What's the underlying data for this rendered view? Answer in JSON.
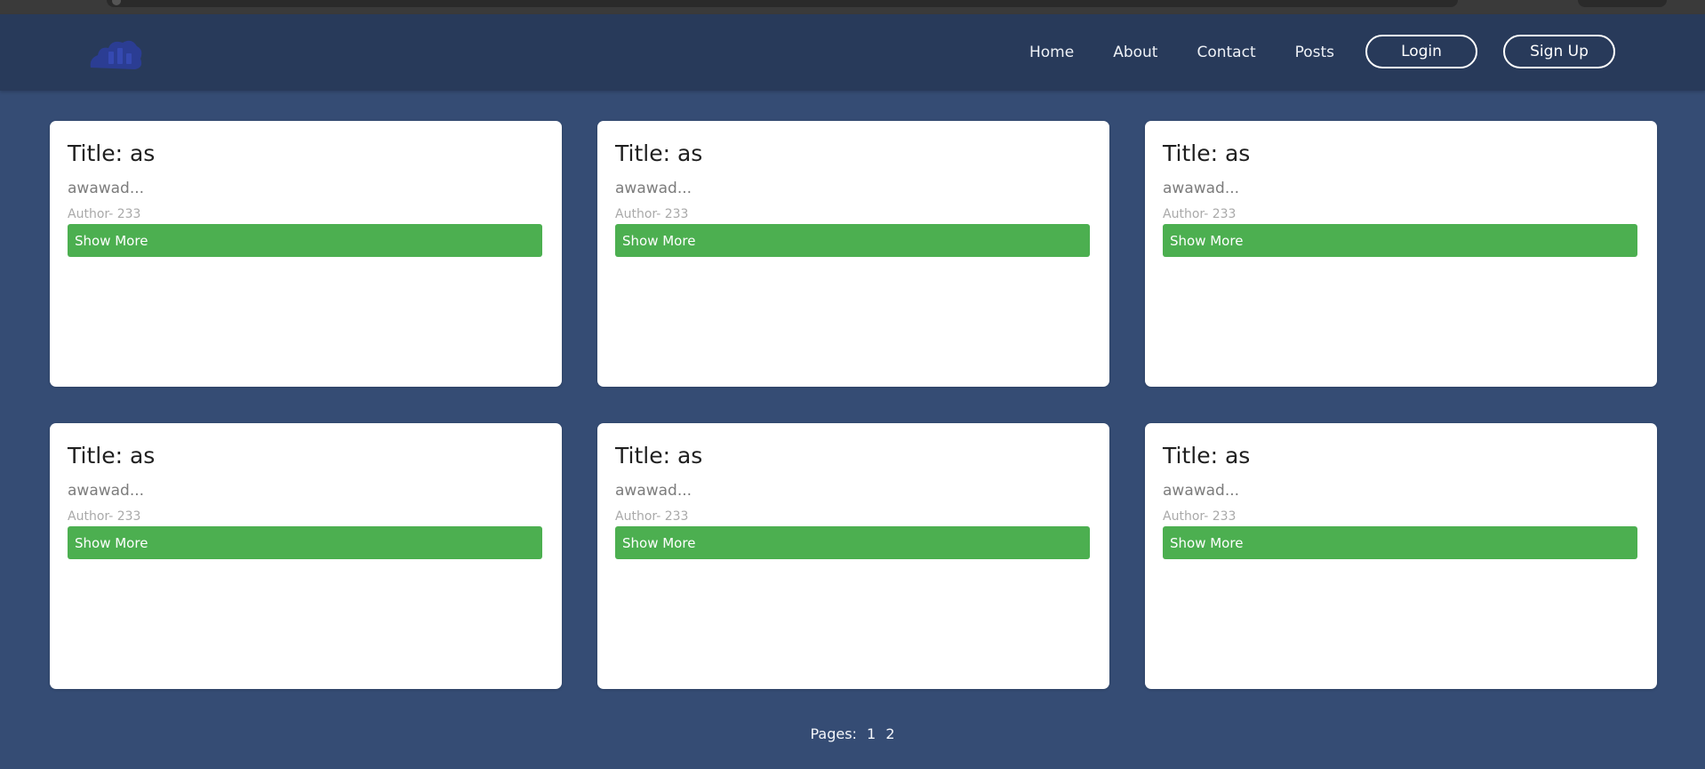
{
  "nav": {
    "links": [
      "Home",
      "About",
      "Contact",
      "Posts"
    ],
    "login_label": "Login",
    "signup_label": "Sign Up"
  },
  "cards": [
    {
      "title": "Title: as",
      "excerpt": "awawad...",
      "author": "Author- 233",
      "button": "Show More"
    },
    {
      "title": "Title: as",
      "excerpt": "awawad...",
      "author": "Author- 233",
      "button": "Show More"
    },
    {
      "title": "Title: as",
      "excerpt": "awawad...",
      "author": "Author- 233",
      "button": "Show More"
    },
    {
      "title": "Title: as",
      "excerpt": "awawad...",
      "author": "Author- 233",
      "button": "Show More"
    },
    {
      "title": "Title: as",
      "excerpt": "awawad...",
      "author": "Author- 233",
      "button": "Show More"
    },
    {
      "title": "Title: as",
      "excerpt": "awawad...",
      "author": "Author- 233",
      "button": "Show More"
    }
  ],
  "pagination": {
    "label": "Pages:",
    "pages": [
      "1",
      "2"
    ]
  },
  "colors": {
    "page_background": "#354c74",
    "navbar_background": "#283a5a",
    "button_green": "#4caf50",
    "logo_blue": "#2c3e9e"
  },
  "icons": {
    "logo": "brand-logo-icon"
  }
}
